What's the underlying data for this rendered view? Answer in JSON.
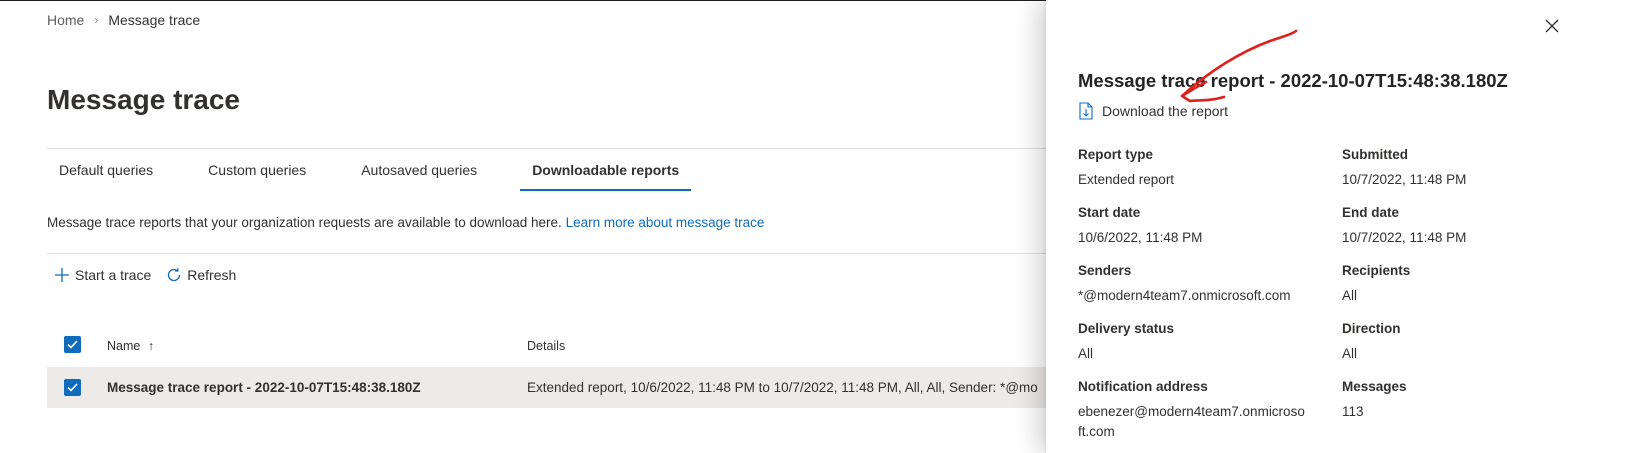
{
  "breadcrumb": {
    "home": "Home",
    "separator": "›",
    "current": "Message trace"
  },
  "page": {
    "title": "Message trace"
  },
  "tabs": [
    {
      "label": "Default queries"
    },
    {
      "label": "Custom queries"
    },
    {
      "label": "Autosaved queries"
    },
    {
      "label": "Downloadable reports",
      "active": true
    }
  ],
  "description": {
    "text": "Message trace reports that your organization requests are available to download here. ",
    "link": "Learn more about message trace"
  },
  "commands": {
    "start_trace": "Start a trace",
    "refresh": "Refresh"
  },
  "grid": {
    "columns": {
      "name": "Name",
      "sort_arrow": "↑",
      "details": "Details"
    },
    "rows": [
      {
        "name": "Message trace report - 2022-10-07T15:48:38.180Z",
        "details": "Extended report, 10/6/2022, 11:48 PM to 10/7/2022, 11:48 PM, All, All, Sender: *@mo"
      }
    ]
  },
  "panel": {
    "title": "Message trace report - 2022-10-07T15:48:38.180Z",
    "download_label": "Download the report",
    "fields": {
      "report_type": {
        "label": "Report type",
        "value": "Extended report"
      },
      "submitted": {
        "label": "Submitted",
        "value": "10/7/2022, 11:48 PM"
      },
      "start_date": {
        "label": "Start date",
        "value": "10/6/2022, 11:48 PM"
      },
      "end_date": {
        "label": "End date",
        "value": "10/7/2022, 11:48 PM"
      },
      "senders": {
        "label": "Senders",
        "value": "*@modern4team7.onmicrosoft.com"
      },
      "recipients": {
        "label": "Recipients",
        "value": "All"
      },
      "delivery_status": {
        "label": "Delivery status",
        "value": "All"
      },
      "direction": {
        "label": "Direction",
        "value": "All"
      },
      "notification_address": {
        "label": "Notification address",
        "value": "ebenezer@modern4team7.onmicrosoft.com"
      },
      "messages": {
        "label": "Messages",
        "value": "113"
      }
    }
  },
  "colors": {
    "accent": "#0f6cbd",
    "row_selected": "#edebe9",
    "annotation": "#e0201a"
  },
  "icons": [
    "chevron-right-icon",
    "plus-icon",
    "refresh-icon",
    "checkmark-icon",
    "close-icon",
    "download-document-icon"
  ]
}
